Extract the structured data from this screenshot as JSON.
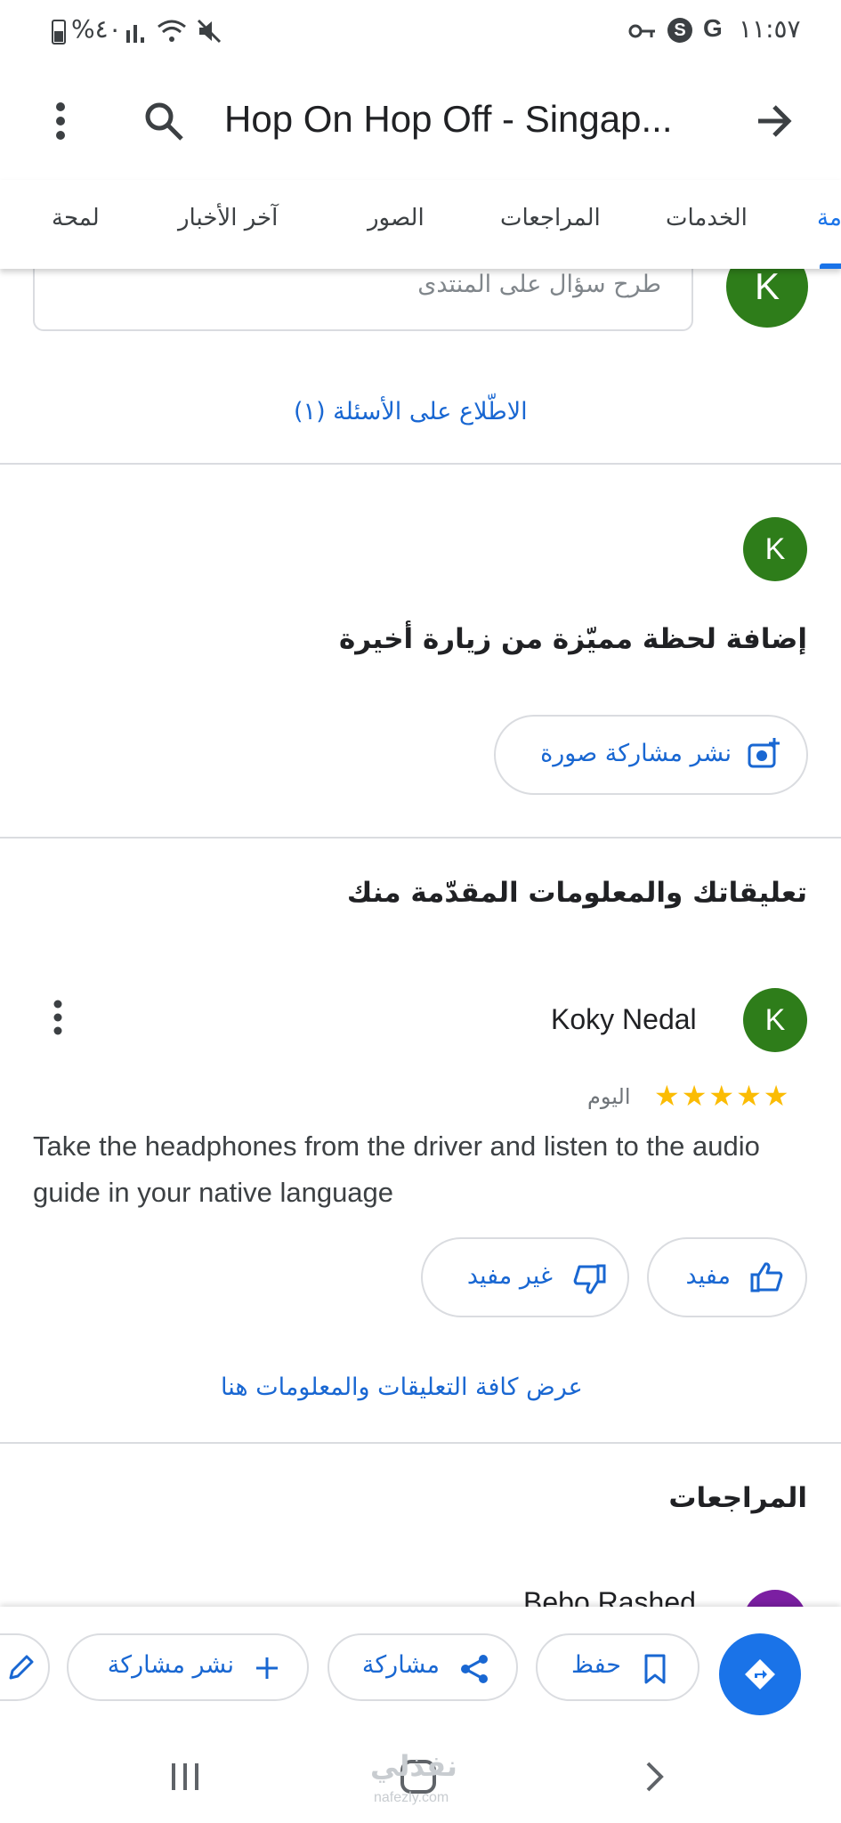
{
  "status_bar": {
    "battery": "%٤٠",
    "time": "١١:٥٧",
    "g_label": "G"
  },
  "header": {
    "title": "Hop On Hop Off - Singap...",
    "menu_icon": "more-vert-icon",
    "search_icon": "search-icon",
    "forward_icon": "arrow-right-icon"
  },
  "tabs": {
    "items": [
      {
        "label": "مة",
        "active": true
      },
      {
        "label": "الخدمات"
      },
      {
        "label": "المراجعات"
      },
      {
        "label": "الصور"
      },
      {
        "label": "آخر الأخبار"
      },
      {
        "label": "لمحة"
      }
    ]
  },
  "questions": {
    "input_placeholder": "طرح سؤال على المنتدى",
    "avatar_letter": "K",
    "see_questions": "الاطّلاع على الأسئلة (١)"
  },
  "add_photo": {
    "avatar_letter": "K",
    "heading": "إضافة لحظة مميّزة من زيارة أخيرة",
    "button_label": "نشر مشاركة صورة"
  },
  "your_reviews": {
    "heading": "تعليقاتك والمعلومات المقدّمة منك",
    "review": {
      "author": "Koky Nedal",
      "avatar_letter": "K",
      "stars": "★★★★★",
      "rating": 5,
      "date": "اليوم",
      "text": "Take the headphones from the driver and listen to the audio guide in your native language",
      "helpful_label": "مفيد",
      "not_helpful_label": "غير مفيد"
    },
    "see_all": "عرض كافة التعليقات والمعلومات هنا"
  },
  "reviews": {
    "heading": "المراجعات",
    "next_author": "Bebo Rashed"
  },
  "bottom_actions": {
    "save_label": "حفظ",
    "share_label": "مشاركة",
    "post_label": "نشر مشاركة"
  },
  "watermark": {
    "brand": "نفذلي",
    "domain": "nafezly.com"
  },
  "colors": {
    "accent": "#1a73e8",
    "avatar_green": "#2e7d1a",
    "star": "#fbbc04"
  }
}
